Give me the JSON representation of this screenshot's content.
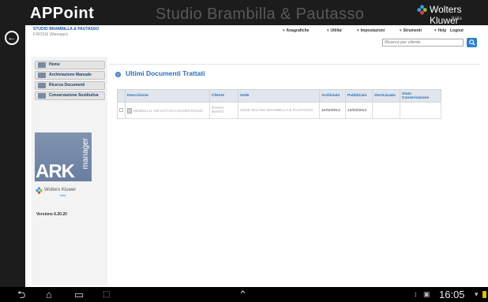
{
  "app": {
    "logo": "APPoint",
    "studio_title": "Studio Brambilla & Pautasso",
    "brand": "Wolters Kluwer",
    "brand_sub": "Italia"
  },
  "firm": {
    "name": "STUDIO BRAMBILLA & PAUTASSO",
    "user": "F.ROSSI (Manager)"
  },
  "menu": [
    {
      "label": "Anagrafiche"
    },
    {
      "label": "Utilita'"
    },
    {
      "label": "Impostazioni"
    },
    {
      "label": "Strumenti"
    },
    {
      "label": "Help"
    }
  ],
  "logout": "Logout",
  "search": {
    "placeholder": "Ricerca per cliente",
    "value": ""
  },
  "sidebar": {
    "items": [
      {
        "label": "Home"
      },
      {
        "label": "Archiviazione Manuale"
      },
      {
        "label": "Ricerca Documenti"
      },
      {
        "label": "Conservazione Sostitutiva"
      }
    ],
    "ark": "ARK",
    "manager": "manager",
    "brand": "Wolters Kluwer",
    "brand_sub": "Italia",
    "version": "Versione 6.20.20"
  },
  "docs": {
    "title": "Ultimi Documenti Trattati",
    "columns": [
      "Descrizione",
      "Cliente",
      "Sede",
      "Archiviato",
      "Pubblicato",
      "Storicizzato",
      "Stato Conservazione"
    ],
    "rows": [
      {
        "descrizione": "MODELLO 730 DATI DI LAVORO ROSSI",
        "cliente": "ROSSI MARIO",
        "sede": "SEDE MILANO BRAMBILLA & PAUTASSO",
        "archiviato": "11/02/2013",
        "pubblicato": "12/03/2013",
        "storicizzato": "",
        "stato": ""
      }
    ]
  },
  "statusbar": {
    "time": "16:05"
  },
  "colors": {
    "accent": "#2a6fb5",
    "header_bg": "#1c1c1c",
    "search_button": "#2e80cc"
  }
}
